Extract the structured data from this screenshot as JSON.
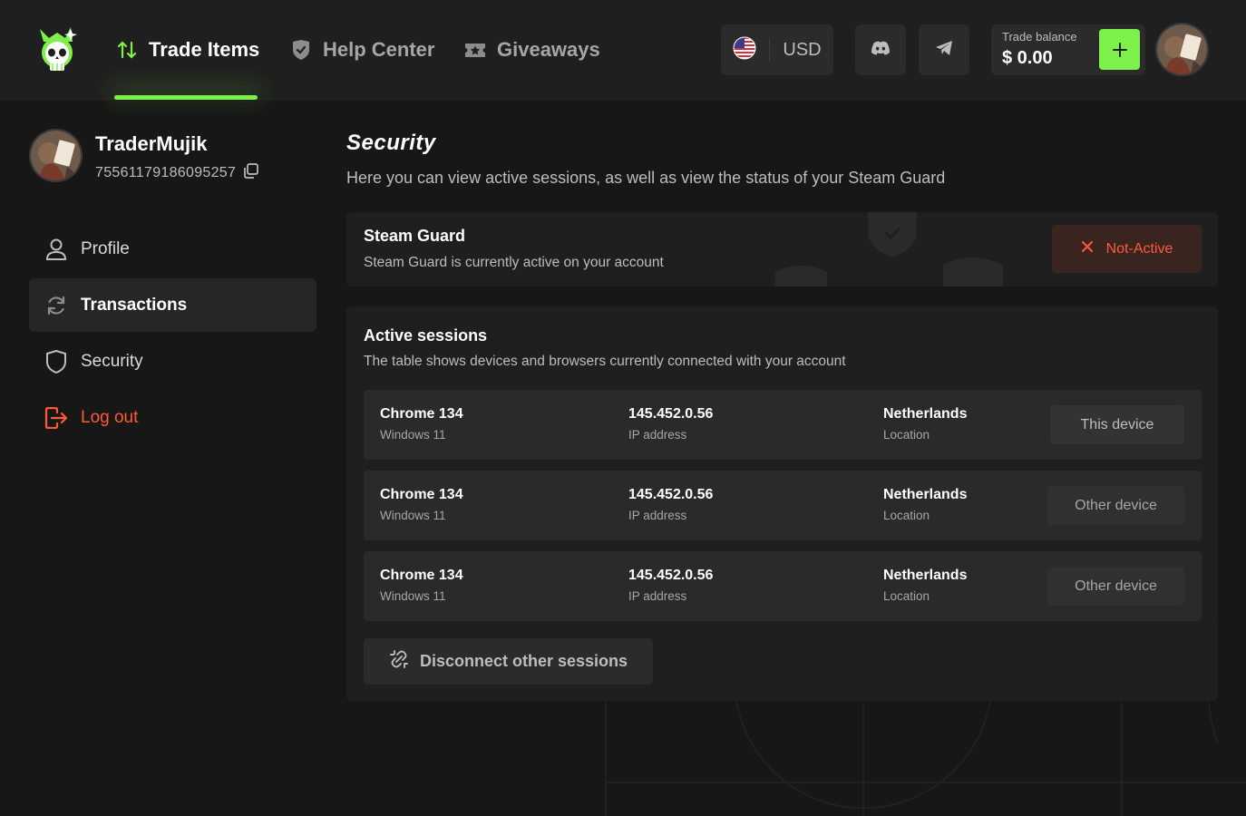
{
  "header": {
    "nav": [
      {
        "label": "Trade Items",
        "icon": "arrows-up-down-icon"
      },
      {
        "label": "Help Center",
        "icon": "shield-check-icon"
      },
      {
        "label": "Giveaways",
        "icon": "ticket-star-icon"
      }
    ],
    "currency": {
      "code": "USD",
      "flag": "us-flag-icon"
    },
    "balance": {
      "label": "Trade balance",
      "value": "$ 0.00"
    },
    "accent": "#7ef04a"
  },
  "user": {
    "name": "TraderMujik",
    "id": "75561179186095257"
  },
  "sidebar": {
    "items": [
      {
        "label": "Profile",
        "icon": "user-icon",
        "active": false
      },
      {
        "label": "Transactions",
        "icon": "refresh-icon",
        "active": true
      },
      {
        "label": "Security",
        "icon": "shield-icon",
        "active": false
      },
      {
        "label": "Log out",
        "icon": "logout-icon",
        "active": false
      }
    ]
  },
  "page": {
    "title": "Security",
    "subtitle": "Here you can view active sessions, as well as view the status of your Steam Guard"
  },
  "steam_guard": {
    "title": "Steam Guard",
    "description": "Steam Guard is currently active on your account",
    "status_label": "Not-Active",
    "status_color": "#ff5a36"
  },
  "sessions": {
    "title": "Active sessions",
    "description": "The table shows devices and browsers currently connected with your account",
    "rows": [
      {
        "browser": "Chrome 134",
        "os": "Windows 11",
        "ip": "145.452.0.56",
        "ip_label": "IP address",
        "country": "Netherlands",
        "country_label": "Location",
        "device": "This device"
      },
      {
        "browser": "Chrome 134",
        "os": "Windows 11",
        "ip": "145.452.0.56",
        "ip_label": "IP address",
        "country": "Netherlands",
        "country_label": "Location",
        "device": "Other device"
      },
      {
        "browser": "Chrome 134",
        "os": "Windows 11",
        "ip": "145.452.0.56",
        "ip_label": "IP address",
        "country": "Netherlands",
        "country_label": "Location",
        "device": "Other device"
      }
    ],
    "disconnect_label": "Disconnect other sessions"
  }
}
